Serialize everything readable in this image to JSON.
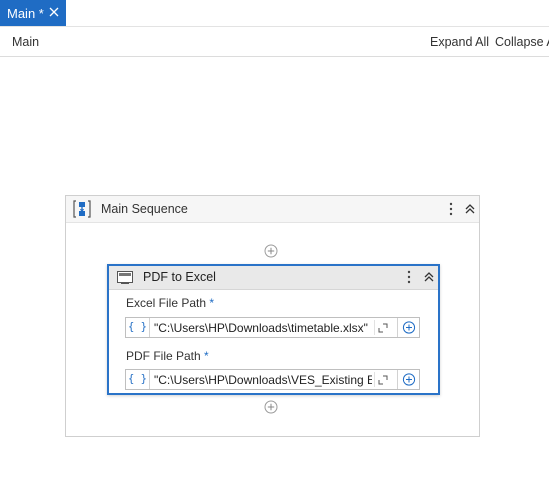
{
  "tab": {
    "label": "Main *"
  },
  "toolbar": {
    "breadcrumb": "Main",
    "expand_all": "Expand All",
    "collapse_all": "Collapse All"
  },
  "sequence": {
    "title": "Main Sequence"
  },
  "activity": {
    "title": "PDF to Excel",
    "excel": {
      "label": "Excel File Path",
      "required": "*",
      "brace": "{ }",
      "value": "\"C:\\Users\\HP\\Downloads\\timetable.xlsx\""
    },
    "pdf": {
      "label": "PDF File Path",
      "required": "*",
      "brace": "{ }",
      "value": "\"C:\\Users\\HP\\Downloads\\VES_Existing Enrollment.pdf\""
    }
  },
  "colors": {
    "accent": "#1f6cc4",
    "activity_border": "#2a73c8"
  },
  "icons": [
    "close-icon",
    "sequence-icon",
    "more-options-icon",
    "collapse-chevron-icon",
    "add-activity-icon",
    "pdf-excel-icon",
    "expand-editor-icon",
    "add-variable-icon"
  ]
}
